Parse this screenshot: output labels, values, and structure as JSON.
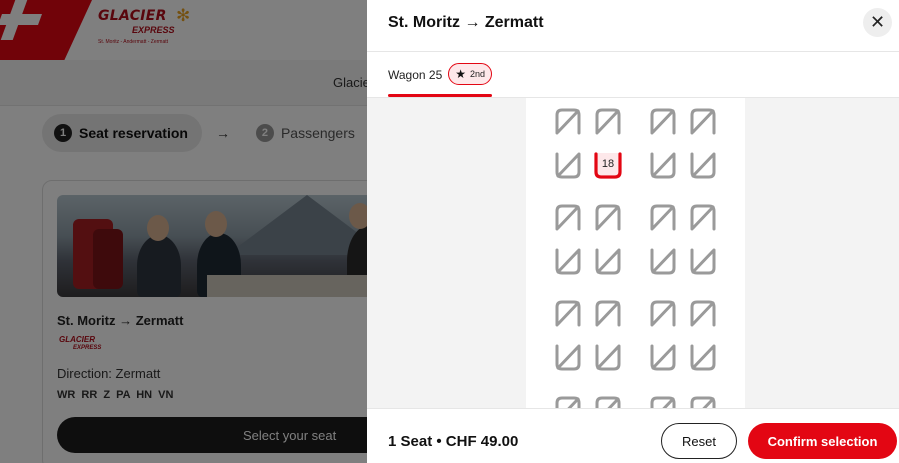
{
  "background": {
    "logo": {
      "name": "GLACIER",
      "sub": "EXPRESS",
      "tagline": "St. Moritz - Andermatt - Zermatt"
    },
    "nav_text": "Glacie",
    "steps": [
      {
        "num": "1",
        "label": "Seat reservation"
      },
      {
        "num": "2",
        "label": "Passengers"
      }
    ],
    "card": {
      "title": "St. Moritz → Zermatt",
      "logo_name": "GLACIER",
      "logo_sub": "EXPRESS",
      "direction": "Direction: Zermatt",
      "codes": "WR RR Z PA HN VN",
      "button": "Select your seat"
    }
  },
  "drawer": {
    "title": "St. Moritz → Zermatt",
    "close_icon": "close-icon",
    "wagon": {
      "label": "Wagon 25",
      "class_label": "2nd",
      "class_icon": "star-icon"
    },
    "selected_seat": "18",
    "summary": "1 Seat • CHF 49.00",
    "reset_label": "Reset",
    "confirm_label": "Confirm selection"
  },
  "colors": {
    "accent": "#e30613",
    "seat_unavailable": "#9a9a9a",
    "dark_button": "#1c1c1c"
  }
}
